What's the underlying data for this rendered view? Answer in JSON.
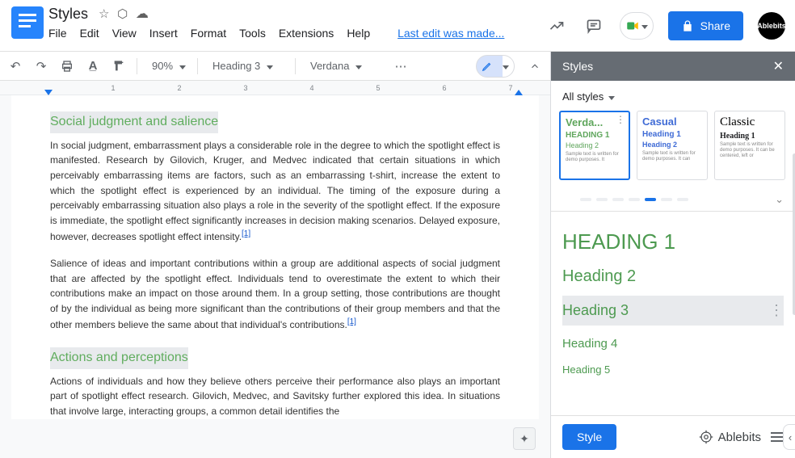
{
  "header": {
    "title": "Styles",
    "menus": [
      "File",
      "Edit",
      "View",
      "Insert",
      "Format",
      "Tools",
      "Extensions",
      "Help"
    ],
    "last_edit": "Last edit was made...",
    "share": "Share",
    "avatar": "Ablebits"
  },
  "toolbar": {
    "zoom": "90%",
    "style": "Heading 3",
    "font": "Verdana"
  },
  "doc": {
    "h3_a": "Social judgment and salience",
    "p1": "In social judgment, embarrassment plays a considerable role in the degree to which the spotlight effect is manifested. Research by Gilovich, Kruger, and Medvec indicated that certain situations in which perceivably embarrassing items are factors, such as an embarrassing t-shirt, increase the extent to which the spotlight effect is experienced by an individual. The timing of the exposure during a perceivably embarrassing situation also plays a role in the severity of the spotlight effect. If the exposure is immediate, the spotlight effect significantly increases in decision making scenarios. Delayed exposure, however, decreases spotlight effect intensity.",
    "ref1": "[1]",
    "p2": "Salience of ideas and important contributions within a group are additional aspects of social judgment that are affected by the spotlight effect. Individuals tend to overestimate the extent to which their contributions make an impact on those around them. In a group setting, those contributions are thought of by the individual as being more significant than the contributions of their group members and that the other members believe the same about that individual's contributions.",
    "ref2": "[1]",
    "h3_b": "Actions and perceptions",
    "p3": "Actions of individuals and how they believe others perceive their performance also plays an important part of spotlight effect research. Gilovich, Medvec, and Savitsky further explored this idea. In situations that involve large, interacting groups, a common detail identifies the"
  },
  "sidebar": {
    "title": "Styles",
    "filter": "All styles",
    "themes": {
      "verdana": {
        "title": "Verda...",
        "h1": "HEADING 1",
        "h2": "Heading 2",
        "sample": "Sample text is written for demo purposes. It"
      },
      "casual": {
        "title": "Casual",
        "h1": "Heading 1",
        "h2": "Heading 2",
        "sample": "Sample text is written for demo purposes. It can"
      },
      "classic": {
        "title": "Classic",
        "h1": "Heading 1",
        "sample": "Sample text is written for demo purposes. It can be centered, left or"
      }
    },
    "headings": {
      "h1": "HEADING 1",
      "h2": "Heading 2",
      "h3": "Heading 3",
      "h4": "Heading 4",
      "h5": "Heading 5"
    },
    "style_btn": "Style",
    "brand": "Ablebits"
  }
}
